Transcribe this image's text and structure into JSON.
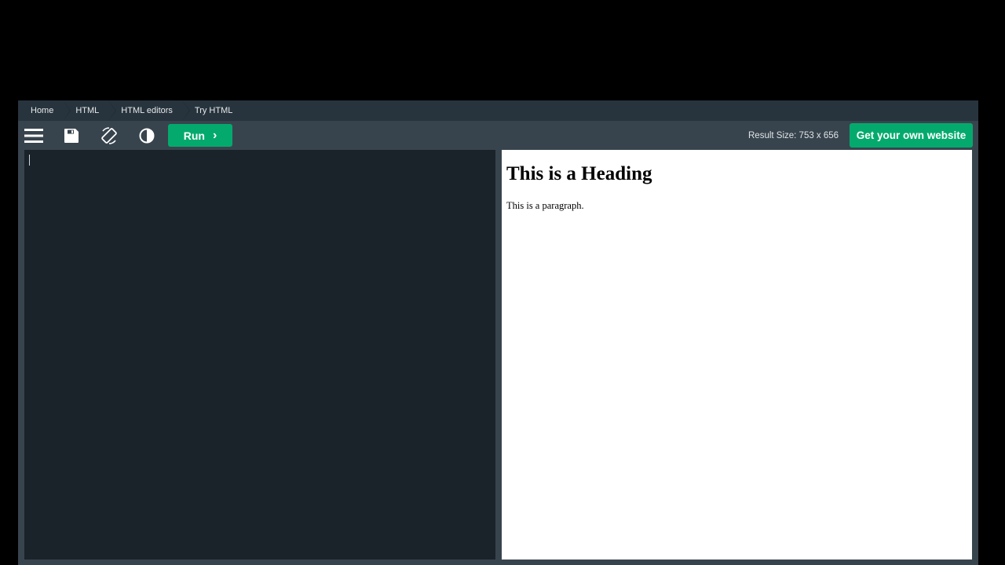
{
  "breadcrumb": [
    {
      "label": "Home"
    },
    {
      "label": "HTML"
    },
    {
      "label": "HTML editors"
    },
    {
      "label": "Try HTML"
    }
  ],
  "toolbar": {
    "icons": [
      "menu-icon",
      "save-icon",
      "rotate-icon",
      "contrast-icon"
    ],
    "run_label": "Run",
    "run_chevron": "›",
    "result_size": "Result Size: 753 x 656",
    "get_site_label": "Get your own website"
  },
  "editor": {
    "content": ""
  },
  "result": {
    "heading": "This is a Heading",
    "paragraph": "This is a paragraph."
  },
  "colors": {
    "background": "#000000",
    "accent": "#04aa6d",
    "toolbar": "#38444d",
    "breadcrumb": "#28343d",
    "editor_bg": "#1a222a",
    "result_bg": "#ffffff"
  }
}
